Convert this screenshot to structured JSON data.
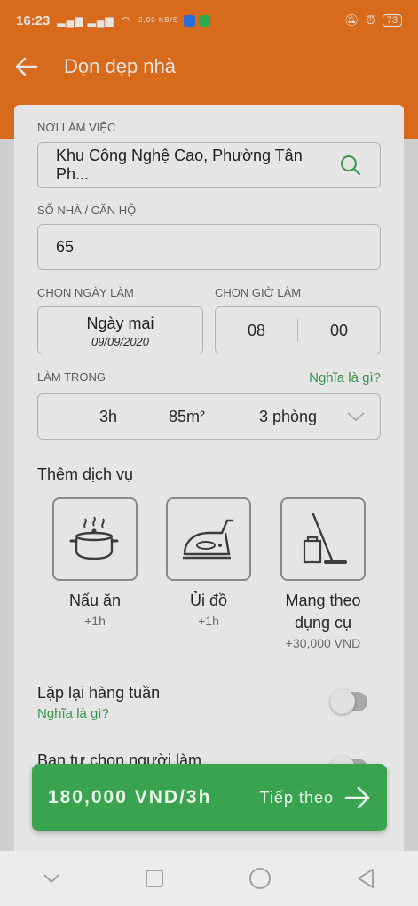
{
  "status_bar": {
    "time": "16:23",
    "network_speed": "2,00 KB/S",
    "battery": "73"
  },
  "app_bar": {
    "title": "Dọn dẹp nhà",
    "back_icon": "arrow-left-icon"
  },
  "form": {
    "location_label": "NƠI LÀM VIỆC",
    "location_value": "Khu Công Nghệ Cao, Phường Tân Ph...",
    "house_label": "SỐ NHÀ / CĂN HỘ",
    "house_value": "65",
    "date_label": "CHỌN NGÀY LÀM",
    "date_primary": "Ngày mai",
    "date_secondary": "09/09/2020",
    "time_label": "CHỌN GIỜ LÀM",
    "time_hour": "08",
    "time_minute": "00",
    "duration_label": "LÀM TRONG",
    "duration_help": "Nghĩa là gì?",
    "duration_hours": "3h",
    "duration_area": "85m²",
    "duration_rooms": "3 phòng"
  },
  "services": {
    "title": "Thêm dịch vụ",
    "items": [
      {
        "name": "Nấu ăn",
        "extra": "+1h",
        "icon": "cooking-pot-icon"
      },
      {
        "name": "Ủi đồ",
        "extra": "+1h",
        "icon": "iron-icon"
      },
      {
        "name_line1": "Mang theo",
        "name_line2": "dụng cụ",
        "extra": "+30,000 VND",
        "icon": "cleaning-tools-icon"
      }
    ]
  },
  "repeat": {
    "label": "Lặp lại hàng tuần",
    "help": "Nghĩa là gì?"
  },
  "choose_worker": {
    "label": "Bạn tự chọn người làm"
  },
  "cta": {
    "price": "180,000 VND/3h",
    "next_label": "Tiếp theo"
  },
  "colors": {
    "primary_orange": "#f0771f",
    "accent_green": "#3eaa52",
    "cta_green": "#3aa350"
  }
}
